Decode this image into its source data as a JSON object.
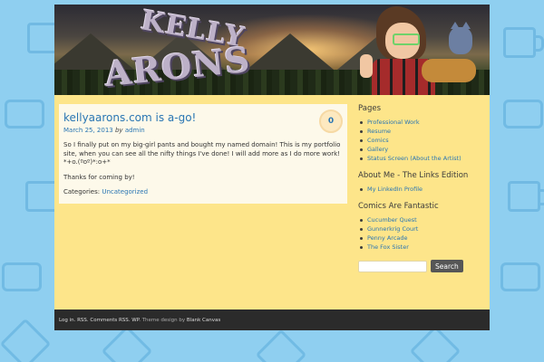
{
  "header": {
    "logo_line1": "KELLY",
    "logo_line2": "ARONS"
  },
  "post": {
    "title": "kellyaarons.com is a-go!",
    "date": "March 25, 2013",
    "by": "by",
    "author": "admin",
    "comment_count": "0",
    "body": [
      "So I finally put on my big-girl pants and bought my named domain! This is my portfolio site, when you can see all the nifty things I've done! I will add more as I do more work! *+o.(ºoº)*:o+*",
      "Thanks for coming by!"
    ],
    "categories_label": "Categories:",
    "category": "Uncategorized"
  },
  "sidebar": {
    "pages_title": "Pages",
    "pages": [
      "Professional Work",
      "Resume",
      "Comics",
      "Gallery",
      "Status Screen (About the Artist)"
    ],
    "about_title": "About Me - The Links Edition",
    "about_links": [
      "My LinkedIn Profile"
    ],
    "comics_title": "Comics Are Fantastic",
    "comics_links": [
      "Cucumber Quest",
      "Gunnerkrig Court",
      "Penny Arcade",
      "The Fox Sister"
    ],
    "search_placeholder": "",
    "search_button": "Search"
  },
  "footer": {
    "login": "Log in",
    "rss": "RSS",
    "comments_rss": "Comments RSS",
    "wp": "WP",
    "theme_text": "Theme design by",
    "theme_name": "Blank Canvas"
  },
  "colors": {
    "background": "#8fcff0",
    "content_bg": "#fde58a",
    "post_bg": "#fdf9ea",
    "link": "#2a76b3",
    "footer_bg": "#2b2b2b"
  }
}
